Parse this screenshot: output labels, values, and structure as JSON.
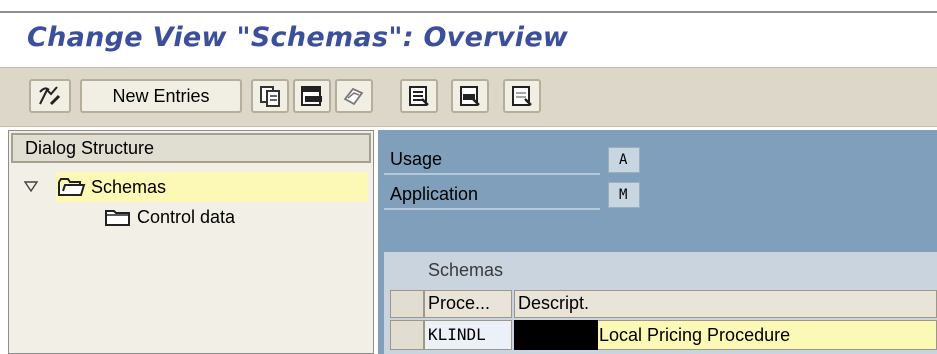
{
  "page": {
    "title": "Change View \"Schemas\": Overview"
  },
  "toolbar": {
    "buttons": [
      {
        "icon": "display-change-icon"
      },
      {
        "label": "New Entries"
      },
      {
        "icon": "copy-icon"
      },
      {
        "icon": "delete-icon"
      },
      {
        "icon": "undo-change-icon"
      },
      {
        "icon": "select-all-icon"
      },
      {
        "icon": "select-block-icon"
      },
      {
        "icon": "deselect-all-icon"
      }
    ]
  },
  "dialog_structure": {
    "header": "Dialog Structure",
    "items": [
      {
        "label": "Schemas",
        "selected": true,
        "expanded": true,
        "icon": "open-folder-icon"
      },
      {
        "label": "Control data",
        "selected": false,
        "icon": "folder-icon"
      }
    ]
  },
  "fields": [
    {
      "label": "Usage",
      "value": "A"
    },
    {
      "label": "Application",
      "value": "M"
    }
  ],
  "table": {
    "title": "Schemas",
    "columns": [
      "Proce...",
      "Descript."
    ],
    "rows": [
      {
        "procedure": "KLINDL",
        "description": "Local Pricing Procedure"
      }
    ]
  },
  "colors": {
    "title": "#3b4f9a",
    "toolbar_bg": "#dcd7c9",
    "right_panel_bg": "#7f9fba",
    "selection": "#fcf8b5"
  }
}
